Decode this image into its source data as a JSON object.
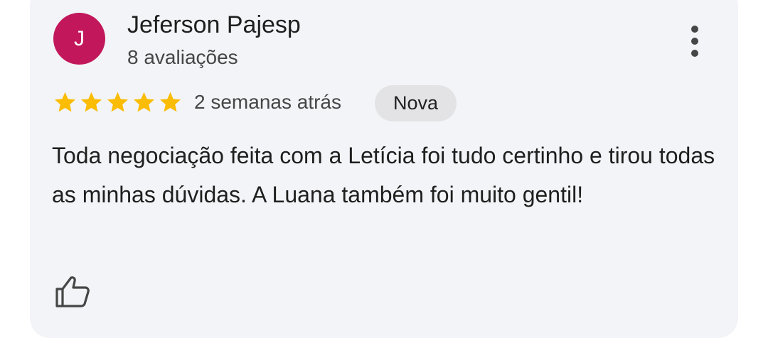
{
  "review": {
    "reviewer": {
      "avatar_letter": "J",
      "avatar_color": "#c2185b",
      "name": "Jeferson Pajesp",
      "review_count": "8 avaliações"
    },
    "rating": 5,
    "rating_max": 5,
    "star_color": "#fbbc04",
    "date": "2 semanas atrás",
    "badge": "Nova",
    "text": "Toda negociação feita com a Letícia foi tudo certinho e tirou todas as minhas dúvidas. A Luana também foi muito gentil!",
    "actions": {
      "more_icon": "more-vert-icon",
      "like_icon": "thumbs-up-icon"
    }
  }
}
